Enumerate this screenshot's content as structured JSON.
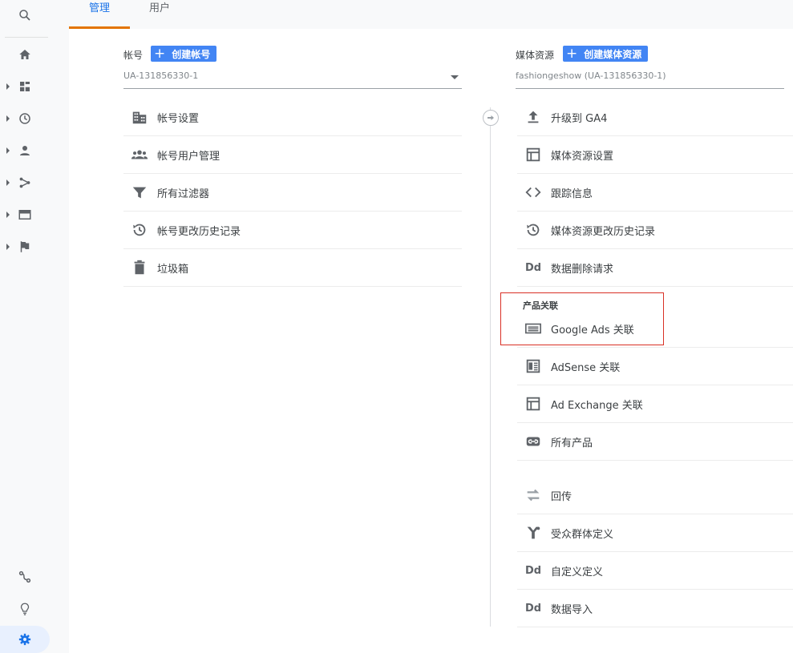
{
  "nav": {
    "items": [
      {
        "icon": "search-icon"
      },
      {
        "icon": "home-icon"
      },
      {
        "icon": "dashboard-icon"
      },
      {
        "icon": "clock-icon"
      },
      {
        "icon": "person-icon"
      },
      {
        "icon": "acquisition-icon"
      },
      {
        "icon": "behavior-icon"
      },
      {
        "icon": "flag-icon"
      },
      {
        "icon": "path-icon"
      },
      {
        "icon": "lightbulb-icon"
      },
      {
        "icon": "gear-icon"
      }
    ]
  },
  "tabs": {
    "admin": "管理",
    "users": "用户"
  },
  "account": {
    "title": "帐号",
    "create_label": "创建帐号",
    "selected": "UA-131856330-1",
    "items": [
      {
        "label": "帐号设置",
        "icon": "building-icon"
      },
      {
        "label": "帐号用户管理",
        "icon": "people-icon"
      },
      {
        "label": "所有过滤器",
        "icon": "filter-icon"
      },
      {
        "label": "帐号更改历史记录",
        "icon": "history-icon"
      },
      {
        "label": "垃圾箱",
        "icon": "trash-icon"
      }
    ]
  },
  "property": {
    "title": "媒体资源",
    "create_label": "创建媒体资源",
    "selected": "fashiongeshow (UA-131856330-1)",
    "items": [
      {
        "label": "升级到 GA4",
        "icon": "upload-icon"
      },
      {
        "label": "媒体资源设置",
        "icon": "window-icon"
      },
      {
        "label": "跟踪信息",
        "icon": "code-icon"
      },
      {
        "label": "媒体资源更改历史记录",
        "icon": "history-icon"
      },
      {
        "label": "数据删除请求",
        "icon": "dd-icon",
        "glyph": "Dd"
      }
    ],
    "product_linking": {
      "heading": "产品关联",
      "items": [
        {
          "label": "Google Ads 关联",
          "icon": "ads-icon"
        },
        {
          "label": "AdSense 关联",
          "icon": "adsense-icon"
        },
        {
          "label": "Ad Exchange 关联",
          "icon": "window-icon"
        },
        {
          "label": "所有产品",
          "icon": "link-icon"
        }
      ]
    },
    "more_items": [
      {
        "label": "回传",
        "icon": "swap-icon"
      },
      {
        "label": "受众群体定义",
        "icon": "audience-icon"
      },
      {
        "label": "自定义定义",
        "icon": "dd-icon",
        "glyph": "Dd"
      },
      {
        "label": "数据导入",
        "icon": "dd-icon",
        "glyph": "Dd"
      }
    ]
  },
  "colors": {
    "accent": "#1a73e8",
    "button": "#4285f4",
    "tab_underline": "#e37400",
    "highlight_border": "#d93025",
    "icon_gray": "#5f6368"
  }
}
